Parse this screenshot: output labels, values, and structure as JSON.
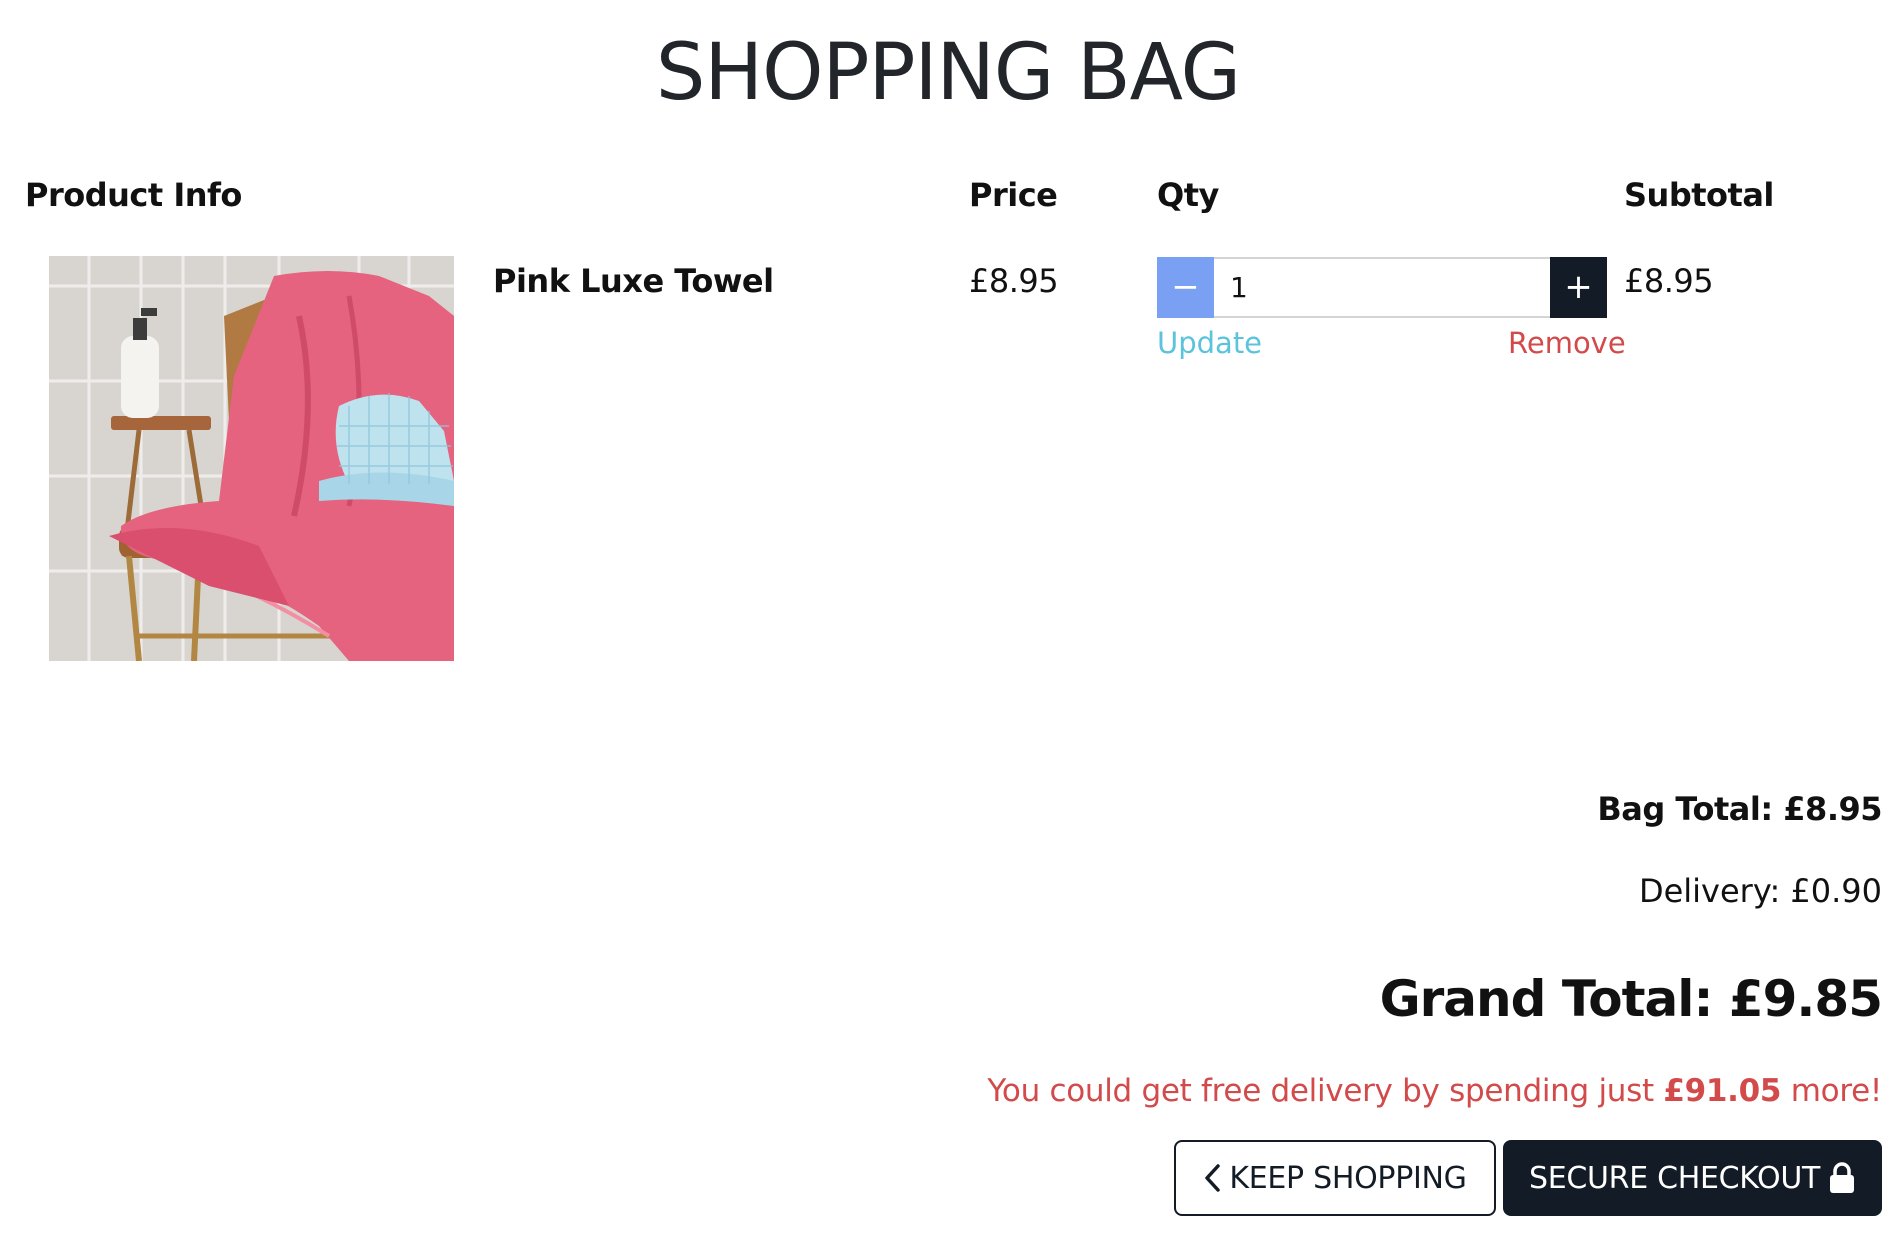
{
  "page": {
    "title": "SHOPPING BAG"
  },
  "table": {
    "headers": {
      "product": "Product Info",
      "price": "Price",
      "qty": "Qty",
      "subtotal": "Subtotal"
    },
    "rows": [
      {
        "name": "Pink Luxe Towel",
        "price": "£8.95",
        "qty": "1",
        "subtotal": "£8.95",
        "update_label": "Update",
        "remove_label": "Remove",
        "minus_symbol": "−",
        "plus_symbol": "+"
      }
    ]
  },
  "summary": {
    "bag_total": "Bag Total: £8.95",
    "delivery": "Delivery: £0.90",
    "grand_total": "Grand Total: £9.85",
    "free_delivery_prefix": "You could get free delivery by spending just ",
    "free_delivery_amount": "£91.05",
    "free_delivery_suffix": " more!"
  },
  "buttons": {
    "keep_shopping": "KEEP SHOPPING",
    "secure_checkout": "SECURE CHECKOUT"
  },
  "icons": {
    "keep_shopping_icon": "chevron-left-icon",
    "checkout_icon": "lock-icon"
  },
  "colors": {
    "primary_dark": "#131c26",
    "minus_button": "#7aa0f4",
    "update_link": "#5bc3dd",
    "remove_link": "#d24a4a",
    "free_delivery_text": "#d24a4a"
  }
}
